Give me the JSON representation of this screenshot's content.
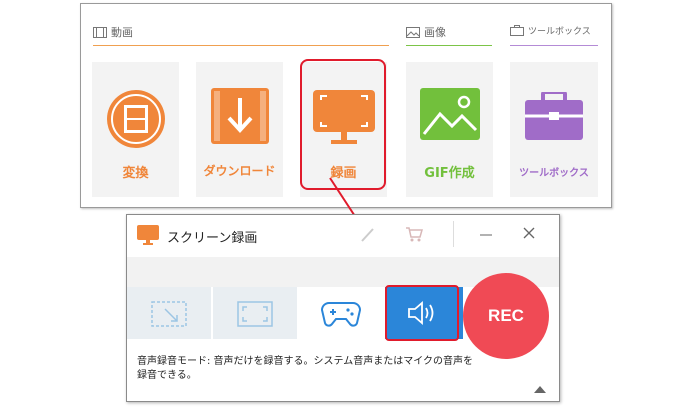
{
  "top_panel": {
    "sections": {
      "video": {
        "label": "動画",
        "icon": "film-strip-icon",
        "color": "#f0a050"
      },
      "image": {
        "label": "画像",
        "icon": "image-icon",
        "color": "#7cc447"
      },
      "toolbox": {
        "label": "ツールボックス",
        "icon": "toolbox-icon",
        "color": "#b48bd6"
      }
    },
    "tiles": [
      {
        "label": "変換",
        "icon": "film-convert-icon",
        "color": "#f0863a"
      },
      {
        "label": "ダウンロード",
        "icon": "download-icon",
        "color": "#f0863a"
      },
      {
        "label": "録画",
        "icon": "screen-record-icon",
        "color": "#f0863a"
      },
      {
        "label": "GIF作成",
        "icon": "picture-icon",
        "color": "#72c03c"
      },
      {
        "label": "ツールボックス",
        "icon": "toolbox-icon",
        "color": "#a06cc8"
      }
    ]
  },
  "window": {
    "title": "スクリーン録画",
    "title_icon": "screen-icon",
    "controls": [
      "brush-icon",
      "cart-icon",
      "minimize-icon",
      "close-icon"
    ],
    "modes": [
      {
        "icon": "region-capture-icon"
      },
      {
        "icon": "fullscreen-capture-icon"
      },
      {
        "icon": "gamepad-icon"
      },
      {
        "icon": "speaker-icon",
        "active": true
      }
    ],
    "rec_label": "REC",
    "description": "音声録音モード: 音声だけを録音する。システム音声またはマイクの音声を録音できる。",
    "description_line1": "音声録音モード: 音声だけを録音する。システム音声またはマイクの音声を",
    "description_line2": "録音できる。"
  },
  "colors": {
    "highlight": "#e01b2c",
    "accent_blue": "#2b86d9",
    "rec_red": "#f04a55"
  }
}
